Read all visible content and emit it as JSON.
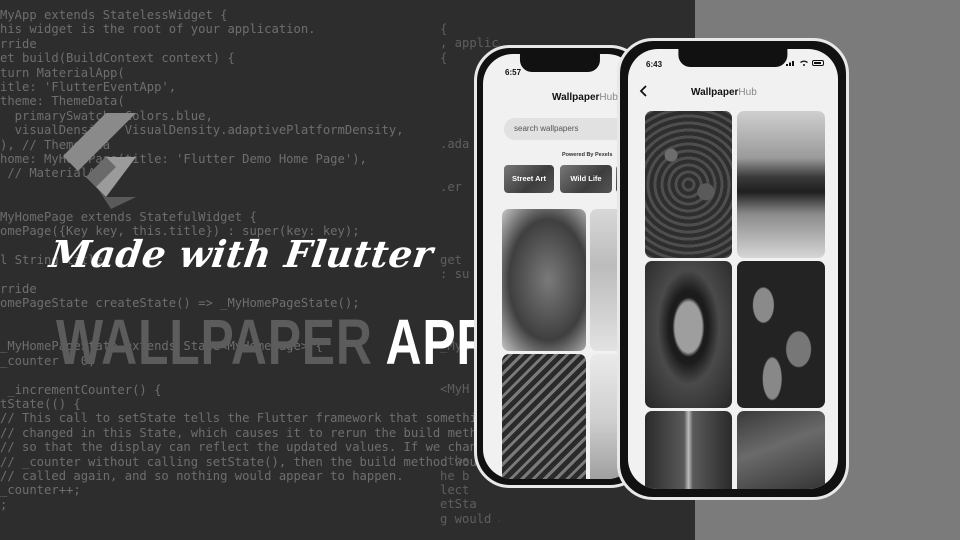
{
  "background_code": [
    "MyApp extends StatelessWidget {",
    "his widget is the root of your application.",
    "rride",
    "et build(BuildContext context) {",
    "turn MaterialApp(",
    "itle: 'FlutterEventApp',",
    "theme: ThemeData(",
    "  primarySwatch: Colors.blue,",
    "  visualDensity: VisualDensity.adaptivePlatformDensity,",
    "), // ThemeData",
    "home: MyHomePage(title: 'Flutter Demo Home Page'),",
    " // MaterialApp",
    "",
    "",
    "MyHomePage extends StatefulWidget {",
    "omePage({Key key, this.title}) : super(key: key);",
    "",
    "l String title;",
    "",
    "rride",
    "omePageState createState() => _MyHomePageState();",
    "",
    "",
    "_MyHomePageState extends State<MyHomePage> {",
    "_counter = 0;",
    "",
    " _incrementCounter() {",
    "tState(() {",
    "// This call to setState tells the Flutter framework that something",
    "// changed in this State, which causes it to rerun the build method",
    "// so that the display can reflect the updated values. If we changed",
    "// _counter without calling setState(), then the build method would",
    "// called again, and so nothing would appear to happen.",
    "_counter++;",
    ";"
  ],
  "background_code_right": [
    "{",
    ", application.",
    "{",
    "",
    "",
    "",
    "",
    "",
    ".ada",
    "",
    "",
    ".er",
    "",
    "",
    "",
    "",
    "get",
    ": su",
    "",
    "",
    "",
    "",
    "_MyH",
    "",
    "",
    "<MyH",
    "",
    "",
    "",
    "",
    " the",
    "he b",
    "lect",
    "etSta",
    "g would appear to happen."
  ],
  "hero": {
    "made_with": "Made with Flutter",
    "title_word1": "WALLPAPER",
    "title_word2": "APP"
  },
  "back_phone": {
    "time": "6:57",
    "app_title_main": "Wallpaper",
    "app_title_accent": "Hub",
    "search_placeholder": "search wallpapers",
    "powered_by": "Powered By Pexels",
    "categories": [
      "Street Art",
      "Wild Life"
    ]
  },
  "front_phone": {
    "time": "6:43",
    "app_title_main": "Wallpaper",
    "app_title_accent": "Hub"
  },
  "colors": {
    "left_bg": "#2d2d2d",
    "right_bg": "#7b7b7b",
    "code_text": "#6e6e6e",
    "title_dim": "#5c5c5c",
    "title_bright": "#ffffff"
  }
}
